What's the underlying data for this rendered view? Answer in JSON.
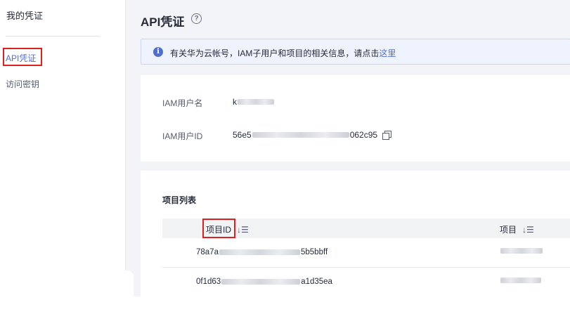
{
  "sidebar": {
    "title": "我的凭证",
    "items": [
      {
        "label": "API凭证",
        "active": true
      },
      {
        "label": "访问密钥",
        "active": false
      }
    ]
  },
  "header": {
    "title": "API凭证",
    "help_icon": "question-circle-icon"
  },
  "notice": {
    "icon": "info-icon",
    "text": "有关华为云帐号，IAM子用户和项目的相关信息，请点击",
    "link": "这里"
  },
  "user_info": {
    "username_label": "IAM用户名",
    "username_value_prefix": "k",
    "userid_label": "IAM用户ID",
    "userid_prefix": "56e5",
    "userid_suffix": "062c95",
    "copy_icon": "copy-icon"
  },
  "projects": {
    "title": "项目列表",
    "columns": [
      "项目ID",
      "项目"
    ],
    "sort_icon": "sort-icon",
    "rows": [
      {
        "id_prefix": "78a7a",
        "id_suffix": "5b5bbff"
      },
      {
        "id_prefix": "0f1d63",
        "id_suffix": "a1d35ea"
      }
    ]
  },
  "colors": {
    "accent": "#526ecc",
    "highlight_box": "#e02020",
    "background": "#f3f4f7"
  }
}
